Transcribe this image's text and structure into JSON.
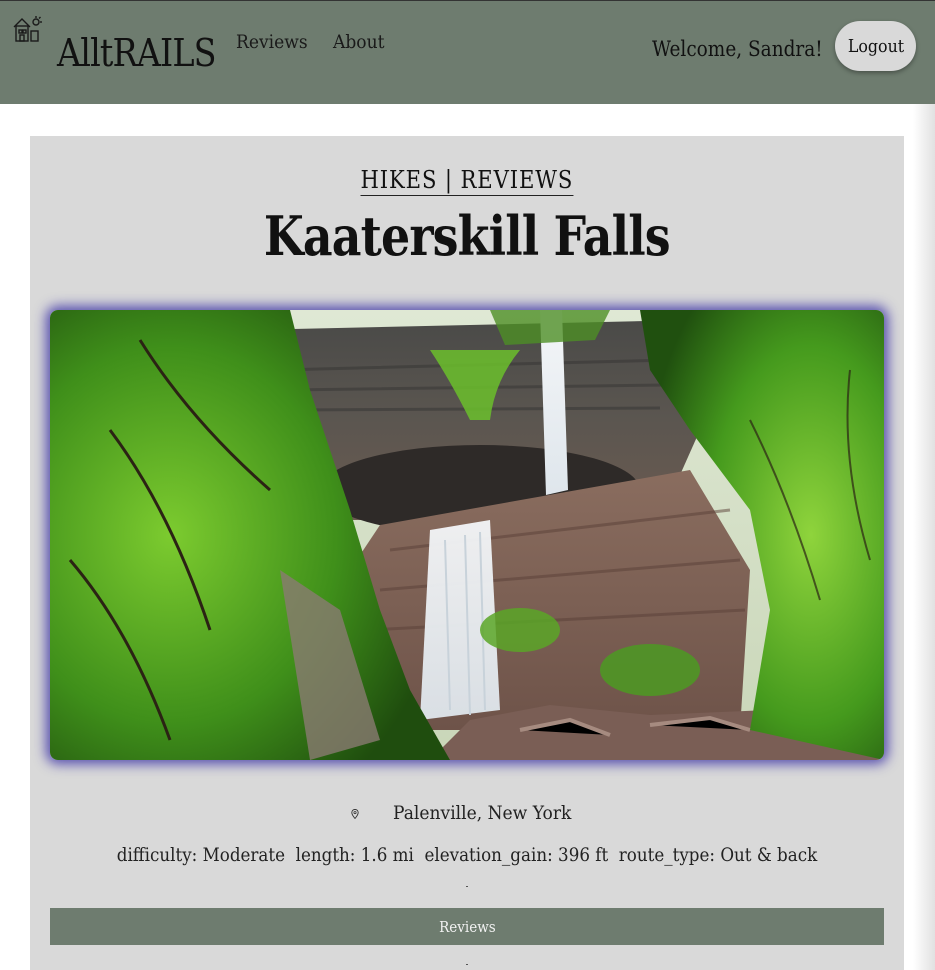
{
  "nav": {
    "brand": "AlltRAILS",
    "links": [
      "Reviews",
      "About"
    ],
    "welcome": "Welcome, Sandra!",
    "logout_label": "Logout"
  },
  "hike": {
    "breadcrumb": "HIKES | REVIEWS",
    "title": "Kaaterskill Falls",
    "location": "Palenville, New York",
    "stats": [
      {
        "label": "difficulty",
        "value": "Moderate"
      },
      {
        "label": "length",
        "value": "1.6 mi"
      },
      {
        "label": "elevation_gain",
        "value": "396 ft"
      },
      {
        "label": "route_type",
        "value": "Out & back"
      }
    ],
    "reviews_button": "Reviews"
  },
  "colors": {
    "navbar": "#6e7c6f",
    "panel": "#d9d9d9",
    "image_glow": "#2a1ea0"
  },
  "icons": [
    "house-logo-icon",
    "location-pin-icon"
  ]
}
